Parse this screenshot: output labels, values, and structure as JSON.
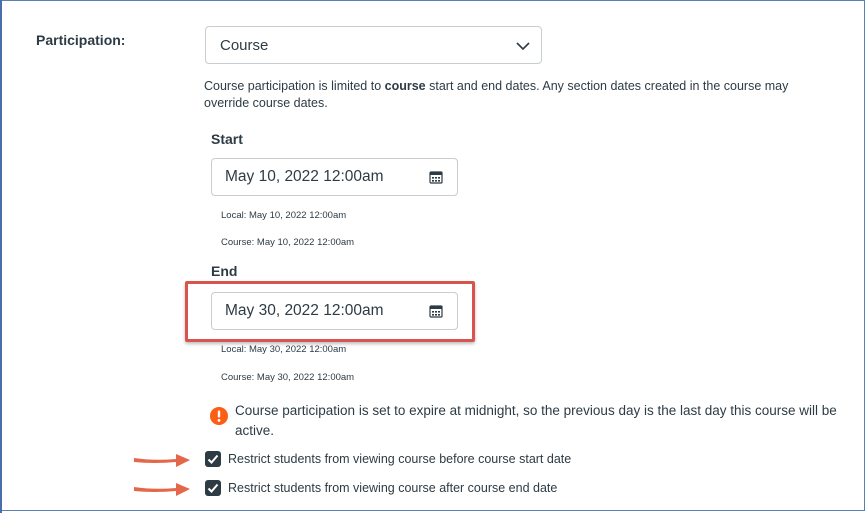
{
  "form": {
    "participation_label": "Participation:",
    "participation_value": "Course",
    "help_prefix": "Course participation is limited to ",
    "help_bold": "course",
    "help_suffix": " start and end dates. Any section dates created in the course may override course dates."
  },
  "start": {
    "heading": "Start",
    "value": "May 10, 2022 12:00am",
    "local": "Local: May 10, 2022 12:00am",
    "course": "Course: May 10, 2022 12:00am"
  },
  "end": {
    "heading": "End",
    "value": "May 30, 2022 12:00am",
    "local": "Local: May 30, 2022 12:00am",
    "course": "Course: May 30, 2022 12:00am"
  },
  "warning": {
    "text": "Course participation is set to expire at midnight, so the previous day is the last day this course will be active."
  },
  "checkboxes": [
    {
      "label": "Restrict students from viewing course before course start date",
      "checked": true
    },
    {
      "label": "Restrict students from viewing course after course end date",
      "checked": true
    }
  ],
  "colors": {
    "highlight": "#d9534f",
    "arrow": "#e4674a",
    "warning": "#fc5e13",
    "checkbox": "#2d3b45"
  },
  "icons": {
    "select": "chevron-down-icon",
    "date": "calendar-icon",
    "warning": "warning-icon",
    "checkbox": "checkmark-icon",
    "annotation": "arrow-right-icon"
  }
}
